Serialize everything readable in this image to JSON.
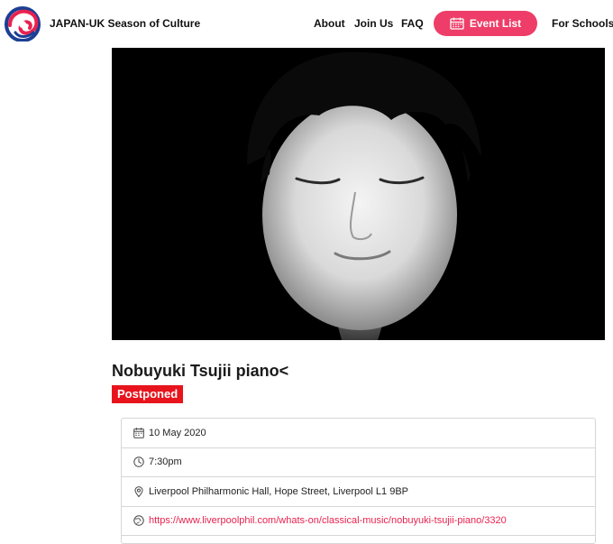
{
  "header": {
    "site_title": "JAPAN-UK Season of Culture",
    "nav": {
      "about": "About",
      "join": "Join Us",
      "faq": "FAQ",
      "event_list": "Event List",
      "schools": "For Schools"
    },
    "accent_color": "#ee3d68"
  },
  "event": {
    "title": "Nobuyuki Tsujii piano<",
    "status_badge": "Postponed",
    "badge_color": "#e8141d",
    "date": "10 May 2020",
    "time": "7:30pm",
    "venue": "Liverpool Philharmonic Hall, Hope Street, Liverpool L1 9BP",
    "website": "https://www.liverpoolphil.com/whats-on/classical-music/nobuyuki-tsujii-piano/3320"
  },
  "icons": {
    "date": "calendar-icon",
    "time": "clock-icon",
    "venue": "map-pin-icon",
    "website": "globe-icon",
    "event_list": "calendar-icon"
  }
}
